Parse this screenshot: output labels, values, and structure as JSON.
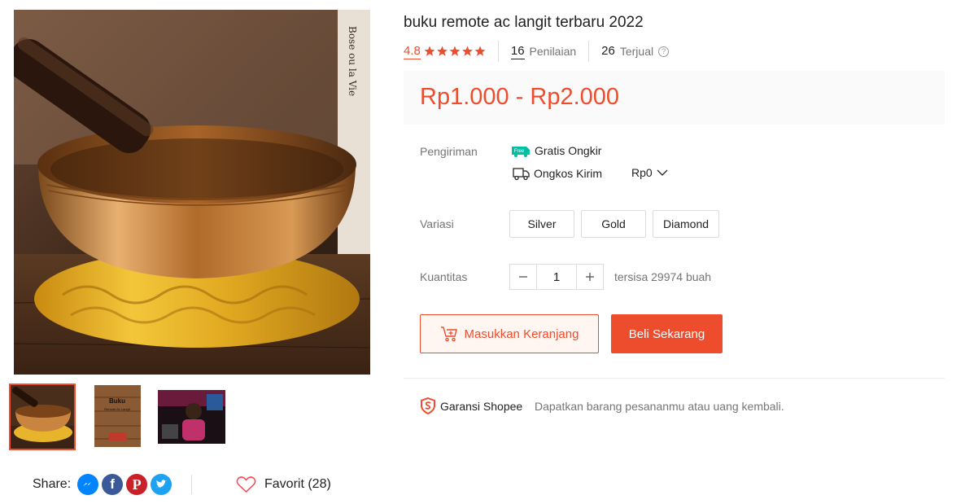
{
  "product": {
    "title": "buku remote ac langit terbaru 2022",
    "rating": "4.8",
    "rating_count": "16",
    "rating_label": "Penilaian",
    "sold_count": "26",
    "sold_label": "Terjual",
    "price": "Rp1.000 - Rp2.000"
  },
  "shipping": {
    "label": "Pengiriman",
    "free_badge": "Free",
    "free_label": "Gratis Ongkir",
    "cost_label": "Ongkos Kirim",
    "cost_value": "Rp0"
  },
  "variation": {
    "label": "Variasi",
    "options": [
      "Silver",
      "Gold",
      "Diamond"
    ]
  },
  "quantity": {
    "label": "Kuantitas",
    "value": "1",
    "stock_text": "tersisa 29974 buah"
  },
  "actions": {
    "add_to_cart": "Masukkan Keranjang",
    "buy_now": "Beli Sekarang"
  },
  "guarantee": {
    "title": "Garansi Shopee",
    "description": "Dapatkan barang pesananmu atau uang kembali."
  },
  "share": {
    "label": "Share:",
    "networks": [
      "messenger-icon",
      "facebook-icon",
      "pinterest-icon",
      "twitter-icon"
    ]
  },
  "favorite": {
    "label": "Favorit (28)"
  },
  "gallery": {
    "thumb2_text_line1": "Buku",
    "thumb2_text_line2": "Remote Ac Langit",
    "main_side_text": "Bose ou la Vie"
  },
  "colors": {
    "accent": "#ee4d2d",
    "free_green": "#00bfa5",
    "messenger": "#0084ff",
    "facebook": "#3b5998",
    "pinterest": "#cb2027",
    "twitter": "#1da1f2"
  }
}
